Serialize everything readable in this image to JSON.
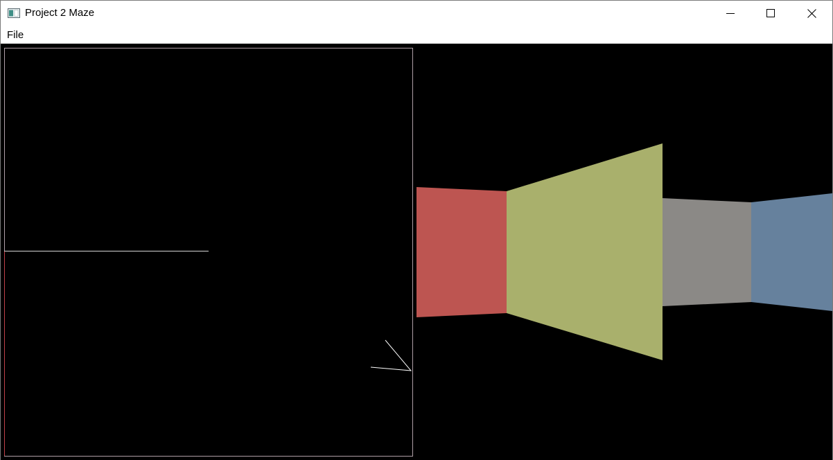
{
  "window": {
    "title": "Project 2 Maze"
  },
  "menubar": {
    "items": [
      {
        "label": "File"
      }
    ]
  },
  "controls": {
    "minimize_icon": "minimize-icon",
    "maximize_icon": "maximize-icon",
    "close_icon": "close-icon"
  },
  "colors": {
    "wall_red": "#bd5551",
    "wall_olive": "#a9b06c",
    "wall_gray": "#8b8986",
    "wall_blue": "#66819d",
    "map_border": "#b0a0a8",
    "map_line": "#ffffff"
  }
}
